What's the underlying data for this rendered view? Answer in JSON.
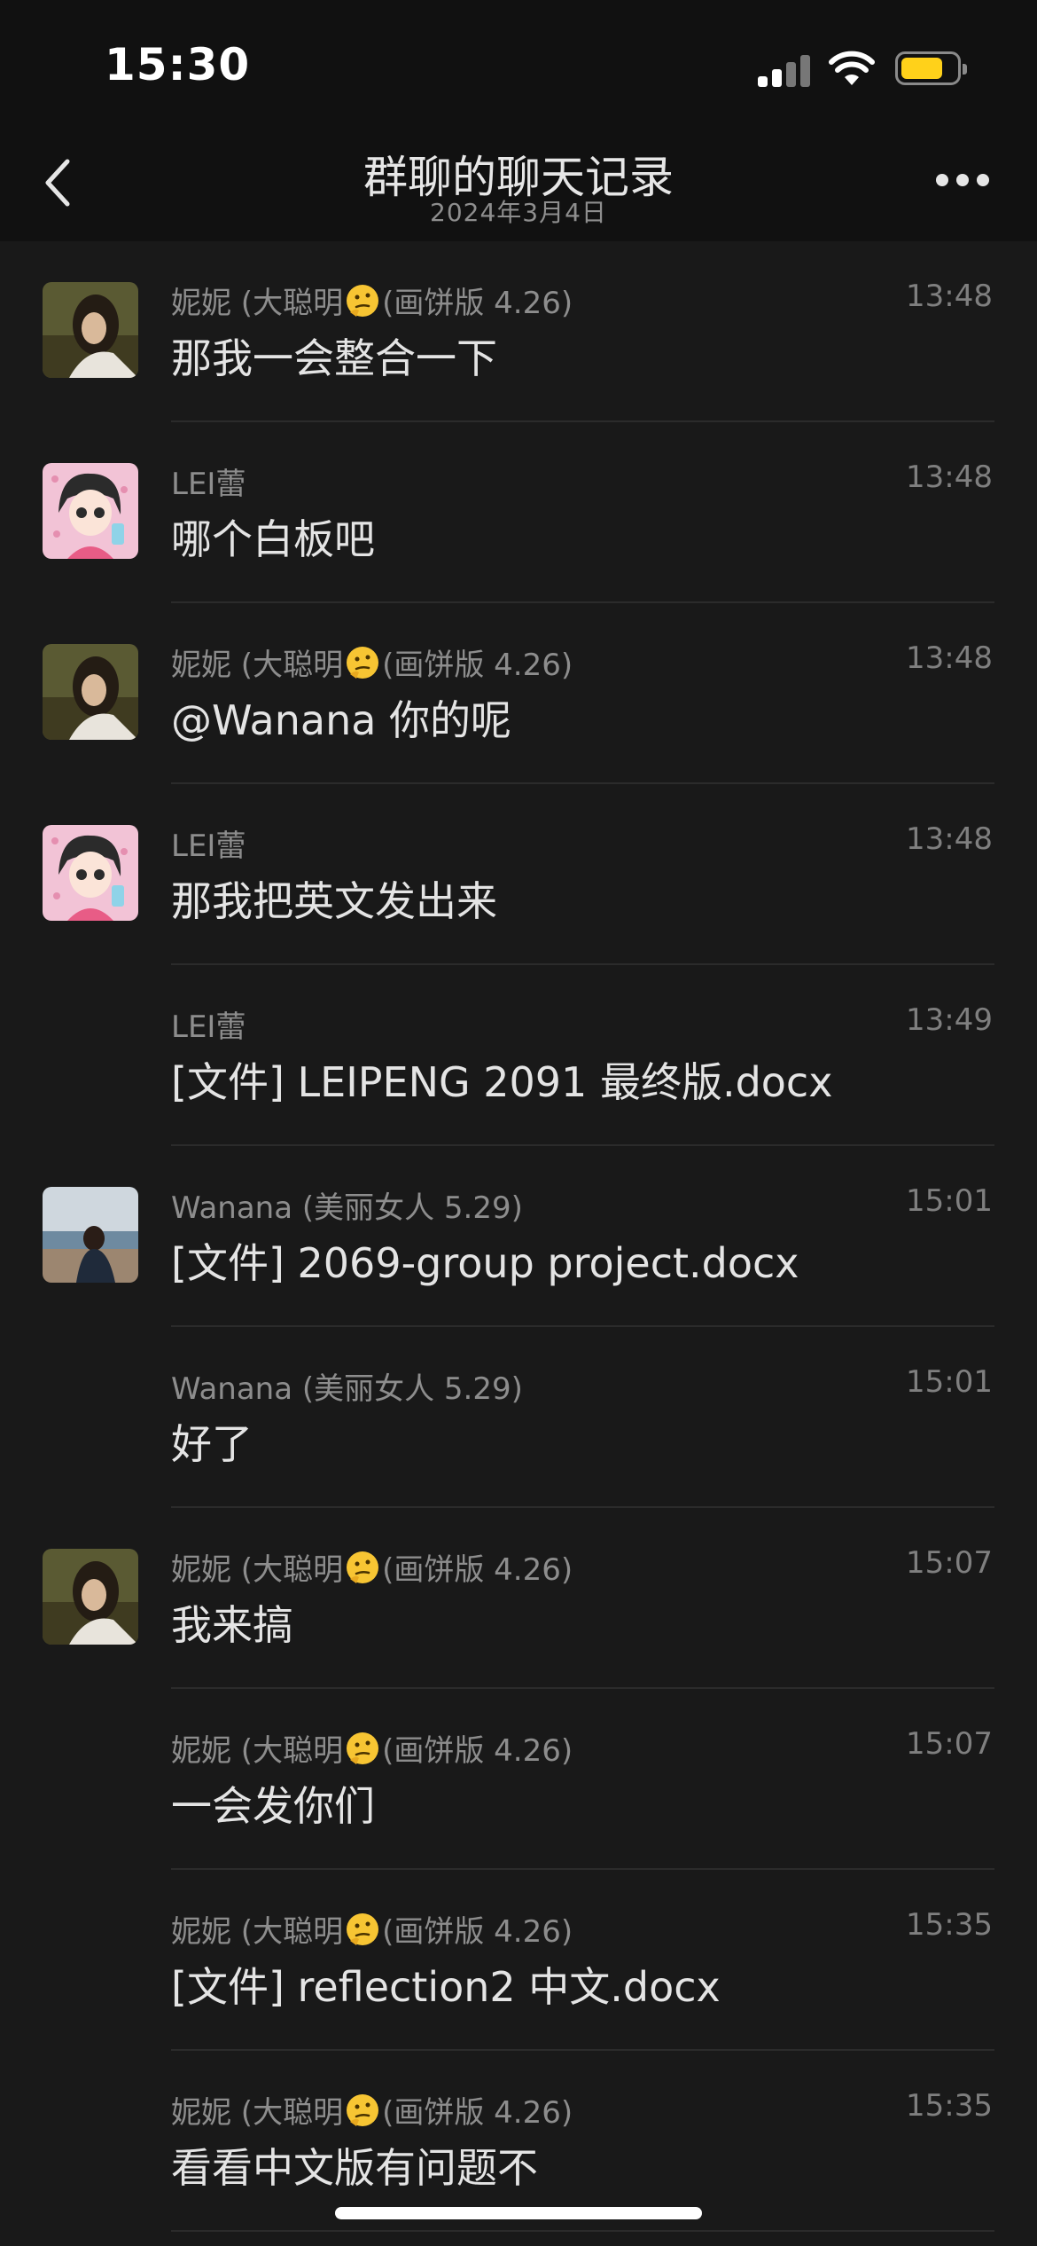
{
  "status_bar": {
    "time": "15:30"
  },
  "nav": {
    "title": "群聊的聊天记录",
    "subtitle": "2024年3月4日"
  },
  "messages": [
    {
      "sender_prefix": "妮妮 (大聪明",
      "sender_suffix": "(画饼版 4.26)",
      "has_emoji": true,
      "time": "13:48",
      "text": "那我一会整合一下",
      "avatar": "nini"
    },
    {
      "sender_prefix": "LEI蕾",
      "sender_suffix": "",
      "has_emoji": false,
      "time": "13:48",
      "text": "哪个白板吧",
      "avatar": "lei"
    },
    {
      "sender_prefix": "妮妮 (大聪明",
      "sender_suffix": "(画饼版 4.26)",
      "has_emoji": true,
      "time": "13:48",
      "text": "@Wanana 你的呢",
      "avatar": "nini"
    },
    {
      "sender_prefix": "LEI蕾",
      "sender_suffix": "",
      "has_emoji": false,
      "time": "13:48",
      "text": "那我把英文发出来",
      "avatar": "lei"
    },
    {
      "sender_prefix": "LEI蕾",
      "sender_suffix": "",
      "has_emoji": false,
      "time": "13:49",
      "text": "[文件] LEIPENG 2091 最终版.docx",
      "avatar": ""
    },
    {
      "sender_prefix": "Wanana (美丽女人 5.29)",
      "sender_suffix": "",
      "has_emoji": false,
      "time": "15:01",
      "text": "[文件] 2069-group project.docx",
      "avatar": "wanana"
    },
    {
      "sender_prefix": "Wanana (美丽女人 5.29)",
      "sender_suffix": "",
      "has_emoji": false,
      "time": "15:01",
      "text": "好了",
      "avatar": ""
    },
    {
      "sender_prefix": "妮妮 (大聪明",
      "sender_suffix": "(画饼版 4.26)",
      "has_emoji": true,
      "time": "15:07",
      "text": "我来搞",
      "avatar": "nini"
    },
    {
      "sender_prefix": "妮妮 (大聪明",
      "sender_suffix": "(画饼版 4.26)",
      "has_emoji": true,
      "time": "15:07",
      "text": "一会发你们",
      "avatar": ""
    },
    {
      "sender_prefix": "妮妮 (大聪明",
      "sender_suffix": "(画饼版 4.26)",
      "has_emoji": true,
      "time": "15:35",
      "text": "[文件] reflection2 中文.docx",
      "avatar": ""
    },
    {
      "sender_prefix": "妮妮 (大聪明",
      "sender_suffix": "(画饼版 4.26)",
      "has_emoji": true,
      "time": "15:35",
      "text": "看看中文版有问题不",
      "avatar": ""
    }
  ]
}
